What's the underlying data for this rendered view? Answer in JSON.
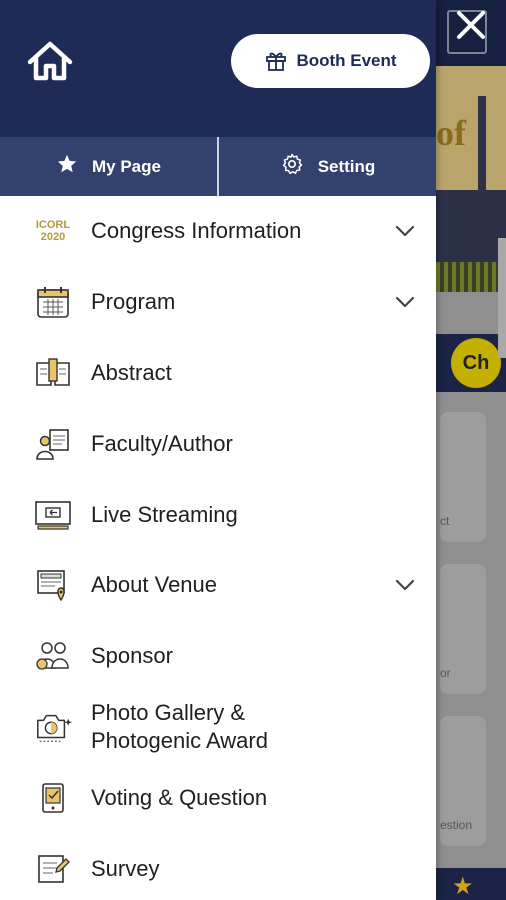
{
  "header": {
    "booth_label": "Booth Event"
  },
  "tabs": [
    {
      "label": "My Page",
      "icon": "star-icon"
    },
    {
      "label": "Setting",
      "icon": "gear-icon"
    }
  ],
  "menu": [
    {
      "label": "Congress Information",
      "icon": "icorl-logo",
      "logo_line1": "ICORL",
      "logo_line2": "2020",
      "expandable": true
    },
    {
      "label": "Program",
      "icon": "calendar-icon",
      "expandable": true
    },
    {
      "label": "Abstract",
      "icon": "book-icon",
      "expandable": false
    },
    {
      "label": "Faculty/Author",
      "icon": "presenter-icon",
      "expandable": false
    },
    {
      "label": "Live Streaming",
      "icon": "screen-icon",
      "expandable": false
    },
    {
      "label": "About Venue",
      "icon": "venue-icon",
      "expandable": true
    },
    {
      "label": "Sponsor",
      "icon": "people-icon",
      "expandable": false
    },
    {
      "label": "Photo Gallery &\nPhotogenic Award",
      "icon": "camera-icon",
      "expandable": false
    },
    {
      "label": "Voting & Question",
      "icon": "tablet-icon",
      "expandable": false
    },
    {
      "label": "Survey",
      "icon": "survey-icon",
      "expandable": false
    }
  ],
  "background": {
    "banner_text": "of",
    "ch_badge": "Ch",
    "card_labels": [
      "ct",
      "or",
      "estion"
    ]
  },
  "colors": {
    "navy": "#1e2b57",
    "tab_blue": "#32416e",
    "gold": "#d1a21b"
  }
}
